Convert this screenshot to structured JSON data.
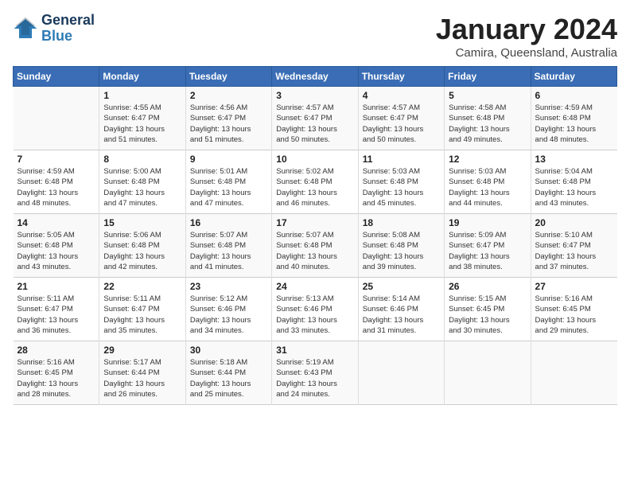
{
  "header": {
    "logo": "GeneralBlue",
    "month": "January 2024",
    "location": "Camira, Queensland, Australia"
  },
  "days_of_week": [
    "Sunday",
    "Monday",
    "Tuesday",
    "Wednesday",
    "Thursday",
    "Friday",
    "Saturday"
  ],
  "weeks": [
    [
      {
        "day": "",
        "info": ""
      },
      {
        "day": "1",
        "info": "Sunrise: 4:55 AM\nSunset: 6:47 PM\nDaylight: 13 hours\nand 51 minutes."
      },
      {
        "day": "2",
        "info": "Sunrise: 4:56 AM\nSunset: 6:47 PM\nDaylight: 13 hours\nand 51 minutes."
      },
      {
        "day": "3",
        "info": "Sunrise: 4:57 AM\nSunset: 6:47 PM\nDaylight: 13 hours\nand 50 minutes."
      },
      {
        "day": "4",
        "info": "Sunrise: 4:57 AM\nSunset: 6:47 PM\nDaylight: 13 hours\nand 50 minutes."
      },
      {
        "day": "5",
        "info": "Sunrise: 4:58 AM\nSunset: 6:48 PM\nDaylight: 13 hours\nand 49 minutes."
      },
      {
        "day": "6",
        "info": "Sunrise: 4:59 AM\nSunset: 6:48 PM\nDaylight: 13 hours\nand 48 minutes."
      }
    ],
    [
      {
        "day": "7",
        "info": "Sunrise: 4:59 AM\nSunset: 6:48 PM\nDaylight: 13 hours\nand 48 minutes."
      },
      {
        "day": "8",
        "info": "Sunrise: 5:00 AM\nSunset: 6:48 PM\nDaylight: 13 hours\nand 47 minutes."
      },
      {
        "day": "9",
        "info": "Sunrise: 5:01 AM\nSunset: 6:48 PM\nDaylight: 13 hours\nand 47 minutes."
      },
      {
        "day": "10",
        "info": "Sunrise: 5:02 AM\nSunset: 6:48 PM\nDaylight: 13 hours\nand 46 minutes."
      },
      {
        "day": "11",
        "info": "Sunrise: 5:03 AM\nSunset: 6:48 PM\nDaylight: 13 hours\nand 45 minutes."
      },
      {
        "day": "12",
        "info": "Sunrise: 5:03 AM\nSunset: 6:48 PM\nDaylight: 13 hours\nand 44 minutes."
      },
      {
        "day": "13",
        "info": "Sunrise: 5:04 AM\nSunset: 6:48 PM\nDaylight: 13 hours\nand 43 minutes."
      }
    ],
    [
      {
        "day": "14",
        "info": "Sunrise: 5:05 AM\nSunset: 6:48 PM\nDaylight: 13 hours\nand 43 minutes."
      },
      {
        "day": "15",
        "info": "Sunrise: 5:06 AM\nSunset: 6:48 PM\nDaylight: 13 hours\nand 42 minutes."
      },
      {
        "day": "16",
        "info": "Sunrise: 5:07 AM\nSunset: 6:48 PM\nDaylight: 13 hours\nand 41 minutes."
      },
      {
        "day": "17",
        "info": "Sunrise: 5:07 AM\nSunset: 6:48 PM\nDaylight: 13 hours\nand 40 minutes."
      },
      {
        "day": "18",
        "info": "Sunrise: 5:08 AM\nSunset: 6:48 PM\nDaylight: 13 hours\nand 39 minutes."
      },
      {
        "day": "19",
        "info": "Sunrise: 5:09 AM\nSunset: 6:47 PM\nDaylight: 13 hours\nand 38 minutes."
      },
      {
        "day": "20",
        "info": "Sunrise: 5:10 AM\nSunset: 6:47 PM\nDaylight: 13 hours\nand 37 minutes."
      }
    ],
    [
      {
        "day": "21",
        "info": "Sunrise: 5:11 AM\nSunset: 6:47 PM\nDaylight: 13 hours\nand 36 minutes."
      },
      {
        "day": "22",
        "info": "Sunrise: 5:11 AM\nSunset: 6:47 PM\nDaylight: 13 hours\nand 35 minutes."
      },
      {
        "day": "23",
        "info": "Sunrise: 5:12 AM\nSunset: 6:46 PM\nDaylight: 13 hours\nand 34 minutes."
      },
      {
        "day": "24",
        "info": "Sunrise: 5:13 AM\nSunset: 6:46 PM\nDaylight: 13 hours\nand 33 minutes."
      },
      {
        "day": "25",
        "info": "Sunrise: 5:14 AM\nSunset: 6:46 PM\nDaylight: 13 hours\nand 31 minutes."
      },
      {
        "day": "26",
        "info": "Sunrise: 5:15 AM\nSunset: 6:45 PM\nDaylight: 13 hours\nand 30 minutes."
      },
      {
        "day": "27",
        "info": "Sunrise: 5:16 AM\nSunset: 6:45 PM\nDaylight: 13 hours\nand 29 minutes."
      }
    ],
    [
      {
        "day": "28",
        "info": "Sunrise: 5:16 AM\nSunset: 6:45 PM\nDaylight: 13 hours\nand 28 minutes."
      },
      {
        "day": "29",
        "info": "Sunrise: 5:17 AM\nSunset: 6:44 PM\nDaylight: 13 hours\nand 26 minutes."
      },
      {
        "day": "30",
        "info": "Sunrise: 5:18 AM\nSunset: 6:44 PM\nDaylight: 13 hours\nand 25 minutes."
      },
      {
        "day": "31",
        "info": "Sunrise: 5:19 AM\nSunset: 6:43 PM\nDaylight: 13 hours\nand 24 minutes."
      },
      {
        "day": "",
        "info": ""
      },
      {
        "day": "",
        "info": ""
      },
      {
        "day": "",
        "info": ""
      }
    ]
  ]
}
